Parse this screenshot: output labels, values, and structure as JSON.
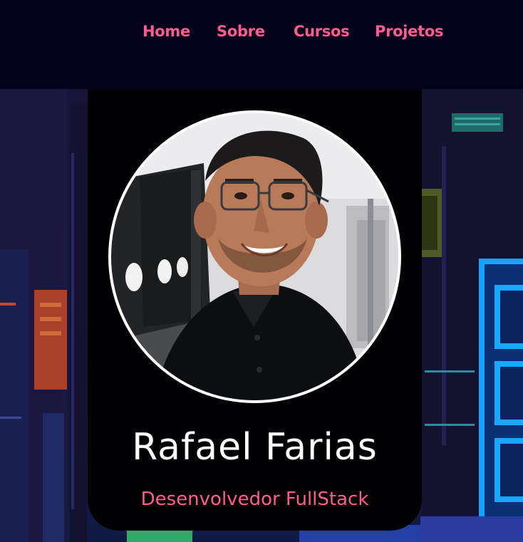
{
  "nav": {
    "items": [
      {
        "label": "Home"
      },
      {
        "label": "Sobre"
      },
      {
        "label": "Cursos"
      },
      {
        "label": "Projetos"
      }
    ]
  },
  "profile": {
    "name": "Rafael Farias",
    "role": "Desenvolvedor FullStack"
  },
  "colors": {
    "navbar_bg": "#03021a",
    "accent_pink": "#ff5c8f",
    "card_bg": "#020205",
    "name_text": "#ffffff",
    "avatar_ring": "#ffffff"
  }
}
